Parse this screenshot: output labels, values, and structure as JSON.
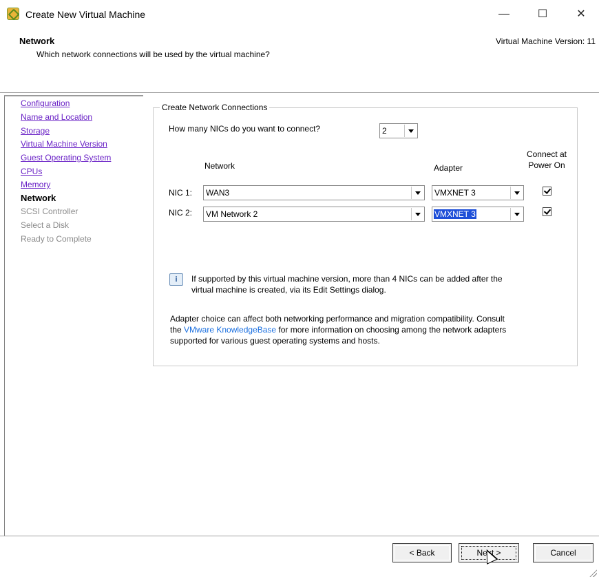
{
  "window": {
    "title": "Create New Virtual Machine",
    "controls": {
      "minimize": "—",
      "maximize": "☐",
      "close": "✕"
    }
  },
  "header": {
    "title": "Network",
    "subtitle": "Which network connections will be used by the virtual machine?",
    "version": "Virtual Machine Version: 11"
  },
  "nav": {
    "items": [
      {
        "label": "Configuration",
        "state": "link"
      },
      {
        "label": "Name and Location",
        "state": "link"
      },
      {
        "label": "Storage",
        "state": "link"
      },
      {
        "label": "Virtual Machine Version",
        "state": "link"
      },
      {
        "label": "Guest Operating System",
        "state": "link"
      },
      {
        "label": "CPUs",
        "state": "link"
      },
      {
        "label": "Memory",
        "state": "link"
      },
      {
        "label": "Network",
        "state": "current"
      },
      {
        "label": "SCSI Controller",
        "state": "disabled"
      },
      {
        "label": "Select a Disk",
        "state": "disabled"
      },
      {
        "label": "Ready to Complete",
        "state": "disabled"
      }
    ]
  },
  "group": {
    "legend": "Create Network Connections",
    "nic_count_question": "How many NICs do you want to connect?",
    "nic_count_value": "2",
    "columns": {
      "network": "Network",
      "adapter": "Adapter",
      "connect_line1": "Connect at",
      "connect_line2": "Power On"
    },
    "nics": [
      {
        "label": "NIC 1:",
        "network": "WAN3",
        "adapter": "VMXNET 3",
        "connect": true
      },
      {
        "label": "NIC 2:",
        "network": "VM Network 2",
        "adapter": "VMXNET 3",
        "connect": true
      }
    ],
    "info_line1": "If supported by this virtual machine version, more than 4 NICs can be added after the",
    "info_line2": "virtual machine is created, via its Edit Settings dialog.",
    "adapter_line1": "Adapter choice can affect both networking performance and migration compatibility. Consult",
    "adapter_line2_pre": "the ",
    "adapter_link": "VMware KnowledgeBase",
    "adapter_line2_post": " for more information on choosing among the network adapters",
    "adapter_line3": "supported for various guest operating systems and hosts."
  },
  "footer": {
    "back": "< Back",
    "next": "Next >",
    "cancel": "Cancel"
  },
  "colors": {
    "link": "#6a22c6",
    "selection": "#1e4fd8",
    "kb_link": "#1a6fe0"
  }
}
